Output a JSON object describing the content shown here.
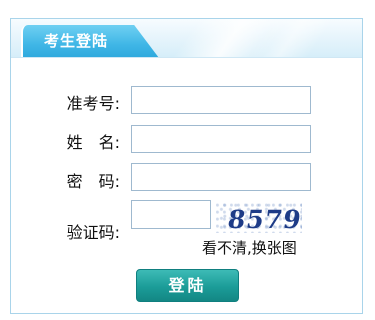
{
  "panel": {
    "title": "考生登陆"
  },
  "form": {
    "exam_id_label": "准考号:",
    "name_label": "姓　名:",
    "password_label": "密　码:",
    "captcha_label": "验证码:",
    "exam_id_value": "",
    "name_value": "",
    "password_value": "",
    "captcha_value": ""
  },
  "captcha": {
    "code": "8579",
    "refresh_text": "看不清,换张图"
  },
  "actions": {
    "login_label": "登陆"
  },
  "colors": {
    "tab": "#3fb6e6",
    "border": "#a9d4ea",
    "button": "#1b9c98"
  }
}
